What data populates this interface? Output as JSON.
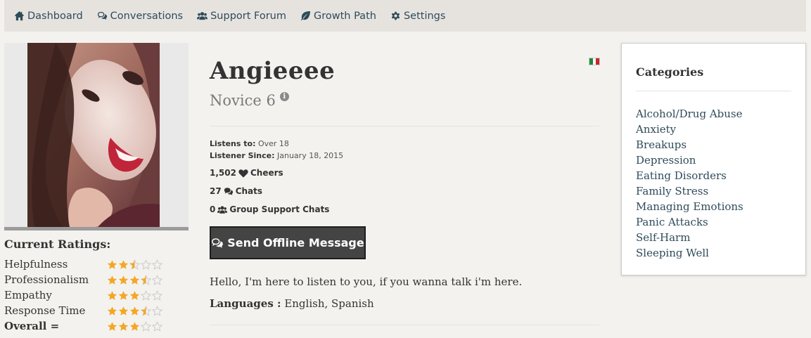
{
  "nav": {
    "items": [
      {
        "label": "Dashboard",
        "icon": "home-icon"
      },
      {
        "label": "Conversations",
        "icon": "comments-icon"
      },
      {
        "label": "Support Forum",
        "icon": "users-icon"
      },
      {
        "label": "Growth Path",
        "icon": "leaf-icon"
      },
      {
        "label": "Settings",
        "icon": "gear-icon"
      }
    ]
  },
  "profile": {
    "name": "Angieeee",
    "rank": "Novice 6",
    "flag": "mexico-flag",
    "listens_to_label": "Listens to:",
    "listens_to_value": "Over 18",
    "listener_since_label": "Listener Since:",
    "listener_since_value": "January 18, 2015",
    "cheers_count": "1,502",
    "cheers_label": "Cheers",
    "chats_count": "27",
    "chats_label": "Chats",
    "group_count": "0",
    "group_label": "Group Support Chats",
    "offline_button": "Send Offline Message",
    "bio": "Hello, I'm here to listen to you, if you wanna talk i'm here.",
    "languages_label": "Languages :",
    "languages_value": "English, Spanish"
  },
  "ratings": {
    "title": "Current Ratings:",
    "rows": [
      {
        "label": "Helpfulness",
        "stars": 2.5
      },
      {
        "label": "Professionalism",
        "stars": 3.5
      },
      {
        "label": "Empathy",
        "stars": 3
      },
      {
        "label": "Response Time",
        "stars": 3.5
      },
      {
        "label": "Overall =",
        "stars": 3
      }
    ]
  },
  "categories": {
    "title": "Categories",
    "items": [
      "Alcohol/Drug Abuse",
      "Anxiety",
      "Breakups",
      "Depression",
      "Eating Disorders",
      "Family Stress",
      "Managing Emotions",
      "Panic Attacks",
      "Self-Harm",
      "Sleeping Well"
    ]
  },
  "colors": {
    "accent_link": "#2e4b5a",
    "star_filled": "#f5a623",
    "button_bg": "#444444"
  }
}
